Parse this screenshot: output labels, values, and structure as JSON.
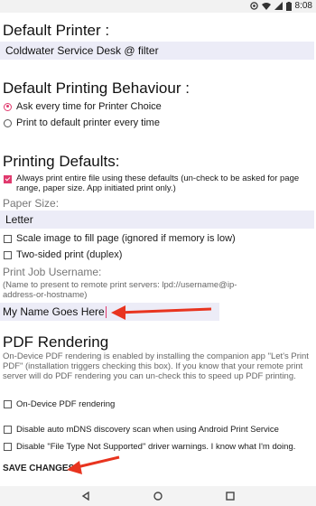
{
  "status": {
    "time": "8:08"
  },
  "default_printer": {
    "heading": "Default Printer :",
    "value": "Coldwater Service Desk @ filter"
  },
  "behaviour": {
    "heading": "Default Printing Behaviour :",
    "options": [
      {
        "label": "Ask every time for Printer Choice",
        "checked": true
      },
      {
        "label": "Print to default printer every time",
        "checked": false
      }
    ]
  },
  "defaults": {
    "heading": "Printing Defaults:",
    "always_print_label": "Always print entire file using these defaults",
    "always_print_note": "(un-check to be asked for page range, paper size. App initiated print only.)",
    "paper_size_label": "Paper Size:",
    "paper_size_value": "Letter",
    "scale_label": "Scale image to fill page (ignored if memory is low)",
    "duplex_label": "Two-sided print (duplex)",
    "username_label": "Print Job Username:",
    "username_note": "(Name to present to remote print servers: lpd://username@ip-address-or-hostname)",
    "username_value": "My Name Goes Here"
  },
  "pdf": {
    "heading": "PDF Rendering",
    "description": "On-Device PDF rendering is enabled by installing the companion app \"Let's Print PDF\" (installation triggers checking this box). If you know that your remote print server will do PDF rendering you can un-check this to speed up PDF printing.",
    "ondevice_label": "On-Device PDF rendering",
    "mdns_label": "Disable auto mDNS discovery scan when using Android Print Service",
    "filetype_label": "Disable \"File Type Not Supported\" driver warnings. I know what I'm doing."
  },
  "save_label": "SAVE CHANGES",
  "colors": {
    "accent": "#e03a6e",
    "field_bg": "#ececf7",
    "arrow": "#e8341f"
  },
  "icons": [
    "wifi-icon",
    "signal-icon",
    "battery-icon",
    "cursor-icon",
    "arrow-icon",
    "back-icon",
    "home-icon",
    "recents-icon"
  ]
}
